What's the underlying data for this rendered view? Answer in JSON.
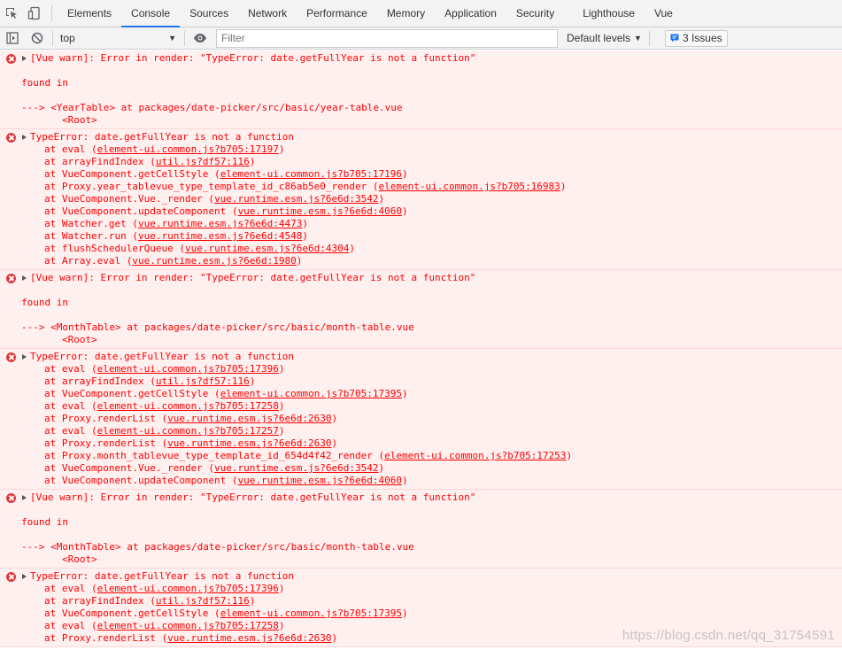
{
  "tabs": [
    "Elements",
    "Console",
    "Sources",
    "Network",
    "Performance",
    "Memory",
    "Application",
    "Security",
    "Lighthouse",
    "Vue"
  ],
  "active_tab": "Console",
  "toolbar": {
    "context": "top",
    "filter_placeholder": "Filter",
    "levels": "Default levels",
    "issues": "3 Issues"
  },
  "messages": [
    {
      "type": "vue-warn",
      "text": "[Vue warn]: Error in render: \"TypeError: date.getFullYear is not a function\"",
      "found_in": "found in",
      "trace": "---> <YearTable> at packages/date-picker/src/basic/year-table.vue",
      "root": "<Root>"
    },
    {
      "type": "type-error",
      "text": "TypeError: date.getFullYear is not a function",
      "stack": [
        {
          "fn": "at eval",
          "src": "element-ui.common.js?b705:17197"
        },
        {
          "fn": "at arrayFindIndex",
          "src": "util.js?df57:116"
        },
        {
          "fn": "at VueComponent.getCellStyle",
          "src": "element-ui.common.js?b705:17196"
        },
        {
          "fn": "at Proxy.year_tablevue_type_template_id_c86ab5e0_render",
          "src": "element-ui.common.js?b705:16983"
        },
        {
          "fn": "at VueComponent.Vue._render",
          "src": "vue.runtime.esm.js?6e6d:3542"
        },
        {
          "fn": "at VueComponent.updateComponent",
          "src": "vue.runtime.esm.js?6e6d:4060"
        },
        {
          "fn": "at Watcher.get",
          "src": "vue.runtime.esm.js?6e6d:4473"
        },
        {
          "fn": "at Watcher.run",
          "src": "vue.runtime.esm.js?6e6d:4548"
        },
        {
          "fn": "at flushSchedulerQueue",
          "src": "vue.runtime.esm.js?6e6d:4304"
        },
        {
          "fn": "at Array.eval",
          "src": "vue.runtime.esm.js?6e6d:1980"
        }
      ]
    },
    {
      "type": "vue-warn",
      "text": "[Vue warn]: Error in render: \"TypeError: date.getFullYear is not a function\"",
      "found_in": "found in",
      "trace": "---> <MonthTable> at packages/date-picker/src/basic/month-table.vue",
      "root": "<Root>"
    },
    {
      "type": "type-error",
      "text": "TypeError: date.getFullYear is not a function",
      "stack": [
        {
          "fn": "at eval",
          "src": "element-ui.common.js?b705:17396"
        },
        {
          "fn": "at arrayFindIndex",
          "src": "util.js?df57:116"
        },
        {
          "fn": "at VueComponent.getCellStyle",
          "src": "element-ui.common.js?b705:17395"
        },
        {
          "fn": "at eval",
          "src": "element-ui.common.js?b705:17258"
        },
        {
          "fn": "at Proxy.renderList",
          "src": "vue.runtime.esm.js?6e6d:2630"
        },
        {
          "fn": "at eval",
          "src": "element-ui.common.js?b705:17257"
        },
        {
          "fn": "at Proxy.renderList",
          "src": "vue.runtime.esm.js?6e6d:2630"
        },
        {
          "fn": "at Proxy.month_tablevue_type_template_id_654d4f42_render",
          "src": "element-ui.common.js?b705:17253"
        },
        {
          "fn": "at VueComponent.Vue._render",
          "src": "vue.runtime.esm.js?6e6d:3542"
        },
        {
          "fn": "at VueComponent.updateComponent",
          "src": "vue.runtime.esm.js?6e6d:4060"
        }
      ]
    },
    {
      "type": "vue-warn",
      "text": "[Vue warn]: Error in render: \"TypeError: date.getFullYear is not a function\"",
      "found_in": "found in",
      "trace": "---> <MonthTable> at packages/date-picker/src/basic/month-table.vue",
      "root": "<Root>"
    },
    {
      "type": "type-error",
      "text": "TypeError: date.getFullYear is not a function",
      "stack": [
        {
          "fn": "at eval",
          "src": "element-ui.common.js?b705:17396"
        },
        {
          "fn": "at arrayFindIndex",
          "src": "util.js?df57:116"
        },
        {
          "fn": "at VueComponent.getCellStyle",
          "src": "element-ui.common.js?b705:17395"
        },
        {
          "fn": "at eval",
          "src": "element-ui.common.js?b705:17258"
        },
        {
          "fn": "at Proxy.renderList",
          "src": "vue.runtime.esm.js?6e6d:2630"
        }
      ]
    }
  ],
  "watermark": "https://blog.csdn.net/qq_31754591"
}
